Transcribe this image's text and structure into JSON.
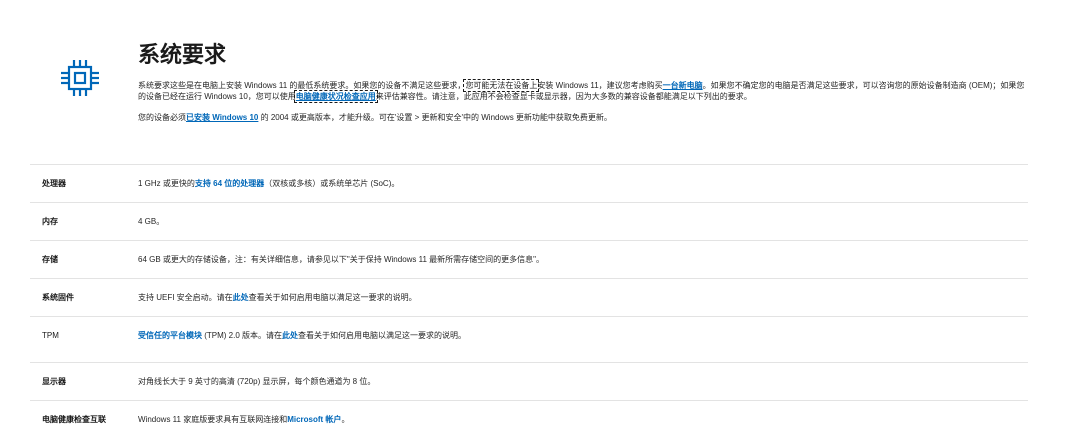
{
  "header": {
    "title": "系统要求"
  },
  "intro": {
    "p1_a": "系统要求这些是在电脑上安装 Windows 11 的最低系统要求。如果您的设备不满足这些要求，",
    "p1_b": "您可能无法在设备上",
    "p1_c": "安装 Windows 11，建议您考虑购买",
    "p1_link_new_pc": "一台新电脑",
    "p1_d": "。如果您不确定您的电脑是否满足这些要求，可以咨询您的原始设备制造商 (OEM)；如果您的设备已经在运行 Windows 10，您可以使用",
    "p1_link_health": "电脑健康状况检查应用",
    "p1_e": "来评估兼容性。请注意，此应用不会检查显卡或显示器，因为大多数的兼容设备都能满足以下列出的要求。",
    "p2_a": "您的设备必须",
    "p2_link": "已安装 Windows 10",
    "p2_b": " 的 2004 或更高版本，才能升级。可在'设置 > 更新和安全'中的 Windows 更新功能中获取免费更新。"
  },
  "specs": {
    "cpu": {
      "label": "处理器",
      "a": "1 GHz 或更快的",
      "link": "支持 64 位的处理器",
      "b": "（双核或多核）或系统单芯片 (SoC)。"
    },
    "ram": {
      "label": "内存",
      "value": "4 GB。"
    },
    "storage": {
      "label": "存储",
      "value": "64 GB 或更大的存储设备，注：有关详细信息，请参见以下\"关于保持 Windows 11 最新所需存储空间的更多信息\"。"
    },
    "firmware": {
      "label": "系统固件",
      "a": "支持 UEFI 安全启动。请在",
      "link": "此处",
      "b": "查看关于如何启用电脑以满足这一要求的说明。"
    },
    "tpm": {
      "label": "TPM",
      "link": "受信任的平台模块",
      "a": " (TPM) 2.0 版本。请在",
      "link2": "此处",
      "b": "查看关于如何启用电脑以满足这一要求的说明。"
    },
    "display": {
      "label": "显示器",
      "value": "对角线长大于 9 英寸的高清 (720p) 显示屏，每个颜色通道为 8 位。"
    },
    "health": {
      "label": "电脑健康检查互联",
      "a": "Windows 11 家庭版要求具有互联网连接和",
      "link": "Microsoft 帐户",
      "b": "。"
    }
  },
  "colors": {
    "accent": "#0067b8",
    "divider": "#e3e3e3"
  },
  "icons": {
    "section": "processor-chip-icon"
  }
}
